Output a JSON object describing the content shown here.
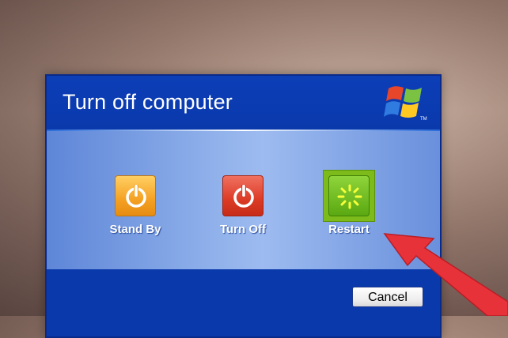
{
  "dialog": {
    "title": "Turn off computer",
    "options": [
      {
        "id": "standby",
        "label": "Stand By"
      },
      {
        "id": "turnoff",
        "label": "Turn Off"
      },
      {
        "id": "restart",
        "label": "Restart"
      }
    ],
    "cancel_label": "Cancel",
    "logo_icon": "windows-xp-flag-icon"
  },
  "colors": {
    "dialog_blue": "#0a39ab",
    "standby": "#f4a123",
    "turnoff": "#dc3b25",
    "restart": "#7dbb1a",
    "pointer_arrow": "#e8323a"
  }
}
